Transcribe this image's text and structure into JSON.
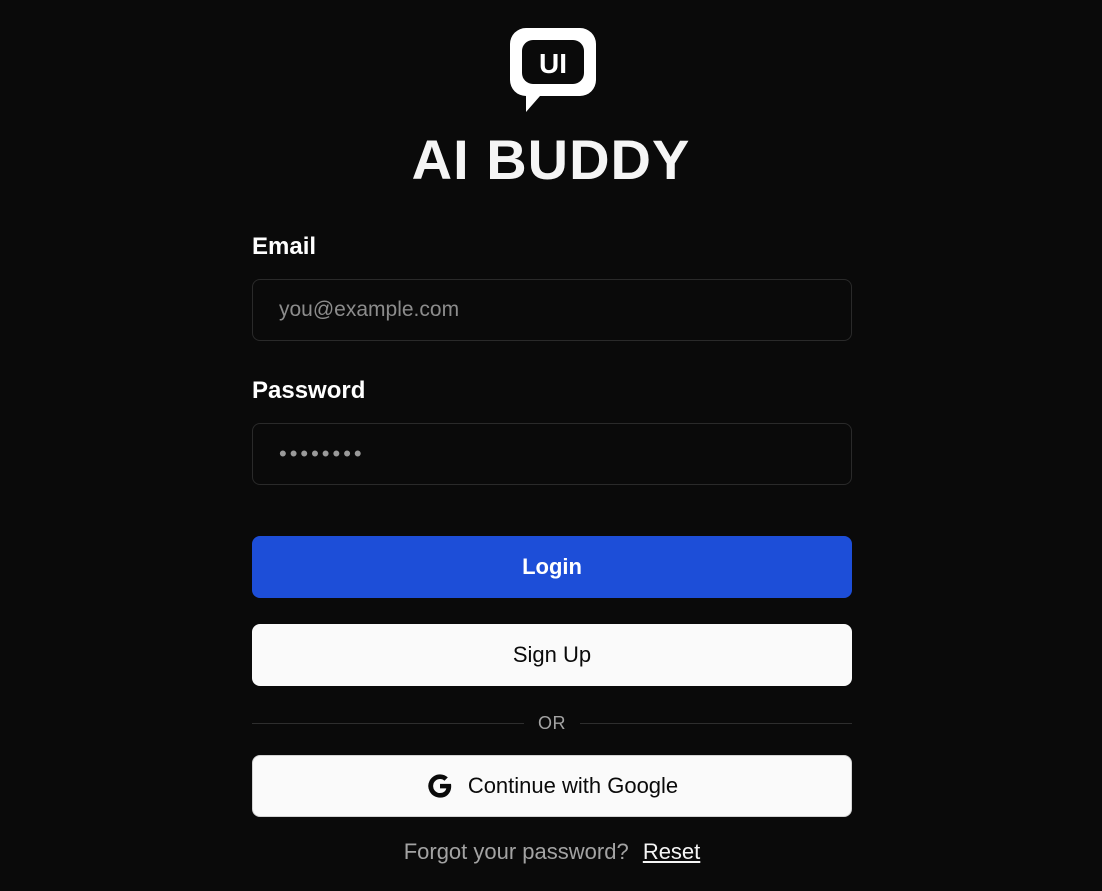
{
  "brand": {
    "logo_text": "UI",
    "title": "AI BUDDY"
  },
  "form": {
    "email": {
      "label": "Email",
      "placeholder": "you@example.com",
      "value": ""
    },
    "password": {
      "label": "Password",
      "value": "••••••••"
    },
    "login_label": "Login",
    "signup_label": "Sign Up",
    "divider_text": "OR",
    "google_label": "Continue with Google",
    "google_icon": "google-icon",
    "forgot_text": "Forgot your password?",
    "reset_label": "Reset"
  },
  "colors": {
    "background": "#0a0a0a",
    "primary": "#1d4ed8",
    "light_button": "#fafafa",
    "muted_text": "#a3a3a3"
  }
}
